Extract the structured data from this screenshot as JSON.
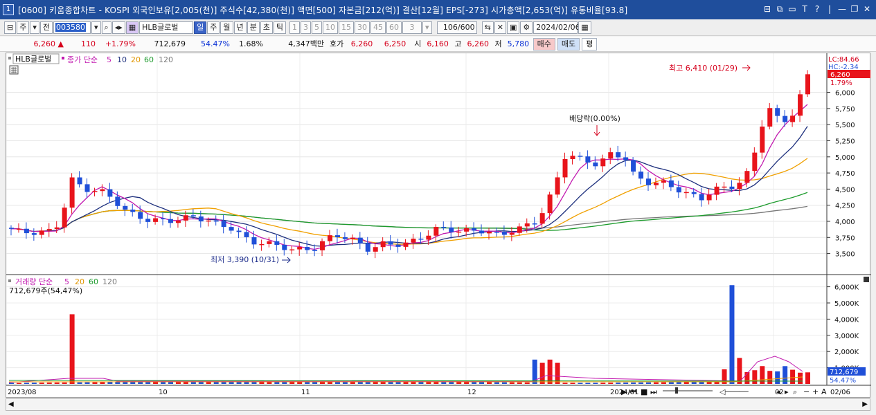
{
  "window": {
    "icon_label": "1",
    "title": "[0600] 키움종합차트 - KOSPI 외국인보유[2,005(천)] 주식수[42,380(천)] 액면[500] 자본금[212(억)] 결산[12월] EPS[-273] 시가총액[2,653(억)] 유통비율[93.8]",
    "controls": [
      "⊟",
      "⧉",
      "▭",
      "T",
      "?",
      "|",
      "—",
      "❐",
      "✕"
    ]
  },
  "toolbar": {
    "type_select": "주",
    "prev_label": "전",
    "code_value": "003580",
    "stock_name": "HLB글로벌",
    "periods": [
      {
        "label": "일",
        "selected": true
      },
      {
        "label": "주",
        "selected": false
      },
      {
        "label": "월",
        "selected": false
      },
      {
        "label": "년",
        "selected": false
      },
      {
        "label": "분",
        "selected": false
      },
      {
        "label": "초",
        "selected": false
      },
      {
        "label": "틱",
        "selected": false
      }
    ],
    "intervals": [
      "1",
      "3",
      "5",
      "10",
      "15",
      "30",
      "45",
      "60"
    ],
    "interval_value": "3",
    "count_value": "106",
    "count_total": "/600",
    "date_value": "2024/02/06"
  },
  "quote": {
    "price": "6,260",
    "change_arrow": "▲",
    "change": "110",
    "change_pct": "+1.79%",
    "volume": "712,679",
    "vol_ratio": "54.47%",
    "turnover": "1.68%",
    "amount": "4,347백만",
    "ask_label": "호가",
    "ask": "6,260",
    "bid": "6,250",
    "open_label": "시",
    "open": "6,160",
    "high_label": "고",
    "high": "6,260",
    "low_label": "저",
    "low": "5,780",
    "buy_label": "매수",
    "sell_label": "매도",
    "ping_label": "평"
  },
  "colors": {
    "up": "#e8141b",
    "down": "#1f4fd8",
    "ma5": "#c21bb0",
    "ma10": "#1d2f7d",
    "ma20": "#f0a000",
    "ma60": "#1c9b2c",
    "ma120": "#777777"
  },
  "chart": {
    "stock_tag": "HLB글로벌",
    "legend_main": {
      "label": "종가 단순",
      "periods": [
        "5",
        "10",
        "20",
        "60",
        "120"
      ]
    },
    "legend_volume": {
      "label": "거래량 단순",
      "periods": [
        "5",
        "20",
        "60",
        "120"
      ]
    },
    "volume_info": "712,679주(54,47%)",
    "price_ticks": [
      "6,000",
      "5,750",
      "5,500",
      "5,250",
      "5,000",
      "4,750",
      "4,500",
      "4,250",
      "4,000",
      "3,750",
      "3,500"
    ],
    "right_badges": {
      "lc": "LC:84.66",
      "hc": "HC:-2.34",
      "price": "6,260",
      "pct": "1.79%"
    },
    "volume_ticks": [
      "6,000K",
      "5,000K",
      "4,000K",
      "3,000K",
      "2,000K",
      "1,000K"
    ],
    "volume_badges": {
      "vol": "712,679",
      "pct": "54.47%"
    },
    "date_labels": [
      "2023/08",
      "10",
      "11",
      "12",
      "2024/01",
      "02",
      "02/06"
    ],
    "annotations": {
      "high": "최고 6,410 (01/29)",
      "low": "최저 3,390 (10/31)",
      "dividend": "배당락(0.00%)"
    }
  }
}
